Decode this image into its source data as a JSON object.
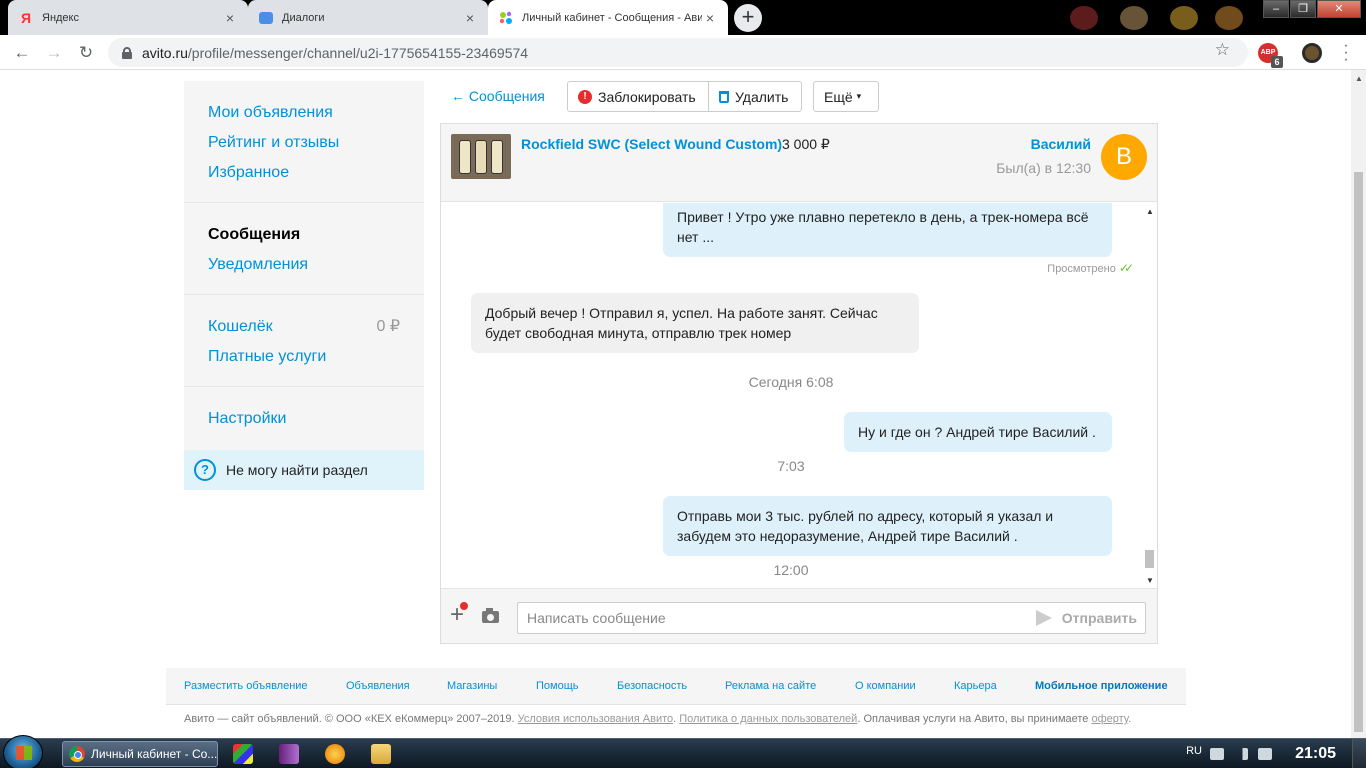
{
  "browser": {
    "tabs": [
      {
        "title": "Яндекс",
        "active": false
      },
      {
        "title": "Диалоги",
        "active": false
      },
      {
        "title": "Личный кабинет - Сообщения - Ави",
        "active": true
      }
    ],
    "url_domain": "avito.ru",
    "url_path": "/profile/messenger/channel/u2i-1775654155-23469574",
    "extension_badge": "ABP",
    "extension_count": "6"
  },
  "sidebar": {
    "group1": [
      "Мои объявления",
      "Рейтинг и отзывы",
      "Избранное"
    ],
    "group2": [
      "Сообщения",
      "Уведомления"
    ],
    "wallet_label": "Кошелёк",
    "wallet_value": "0 ₽",
    "paid_label": "Платные услуги",
    "settings_label": "Настройки",
    "help_label": "Не могу найти раздел"
  },
  "chat_toolbar": {
    "back_label": "← Сообщения",
    "block_label": "Заблокировать",
    "delete_label": "Удалить",
    "more_label": "Ещё"
  },
  "chat": {
    "product_name": "Rockfield SWC (Select Wound Custom)",
    "price": "3 000 ₽",
    "user_name": "Василий",
    "user_seen": "Был(а) в 12:30",
    "avatar_letter": "В",
    "messages": [
      {
        "dir": "out",
        "text": "Привет ! Утро уже плавно перетекло в день, а трек-номера всё нет ..."
      },
      {
        "dir": "in",
        "text": "Добрый вечер ! Отправил я, успел. На работе занят. Сейчас будет свободная минута, отправлю трек номер"
      },
      {
        "dir": "out",
        "text": "Ну и где он ? Андрей тире Василий ."
      },
      {
        "dir": "out",
        "text": "Отправь мои 3 тыс. рублей по адресу, который я указал и забудем это недоразумение, Андрей тире Василий ."
      }
    ],
    "seen_label": "Просмотрено",
    "timestamps": [
      "Сегодня 6:08",
      "7:03",
      "12:00"
    ],
    "input_placeholder": "Написать сообщение",
    "send_label": "Отправить"
  },
  "footer": {
    "links": [
      "Разместить объявление",
      "Объявления",
      "Магазины",
      "Помощь",
      "Безопасность",
      "Реклама на сайте",
      "О компании",
      "Карьера",
      "Мобильное приложение"
    ],
    "copyright": "Авито — сайт объявлений. © ООО «КЕХ еКоммерц» 2007–2019.",
    "terms_link": "Условия использования Авито",
    "privacy_link": "Политика о данных пользователей",
    "paying_text": "Оплачивая услуги на Авито, вы принимаете",
    "offer_link": "оферту"
  },
  "taskbar": {
    "task_title": "Личный кабинет - Со...",
    "lang": "RU",
    "time": "21:05"
  }
}
